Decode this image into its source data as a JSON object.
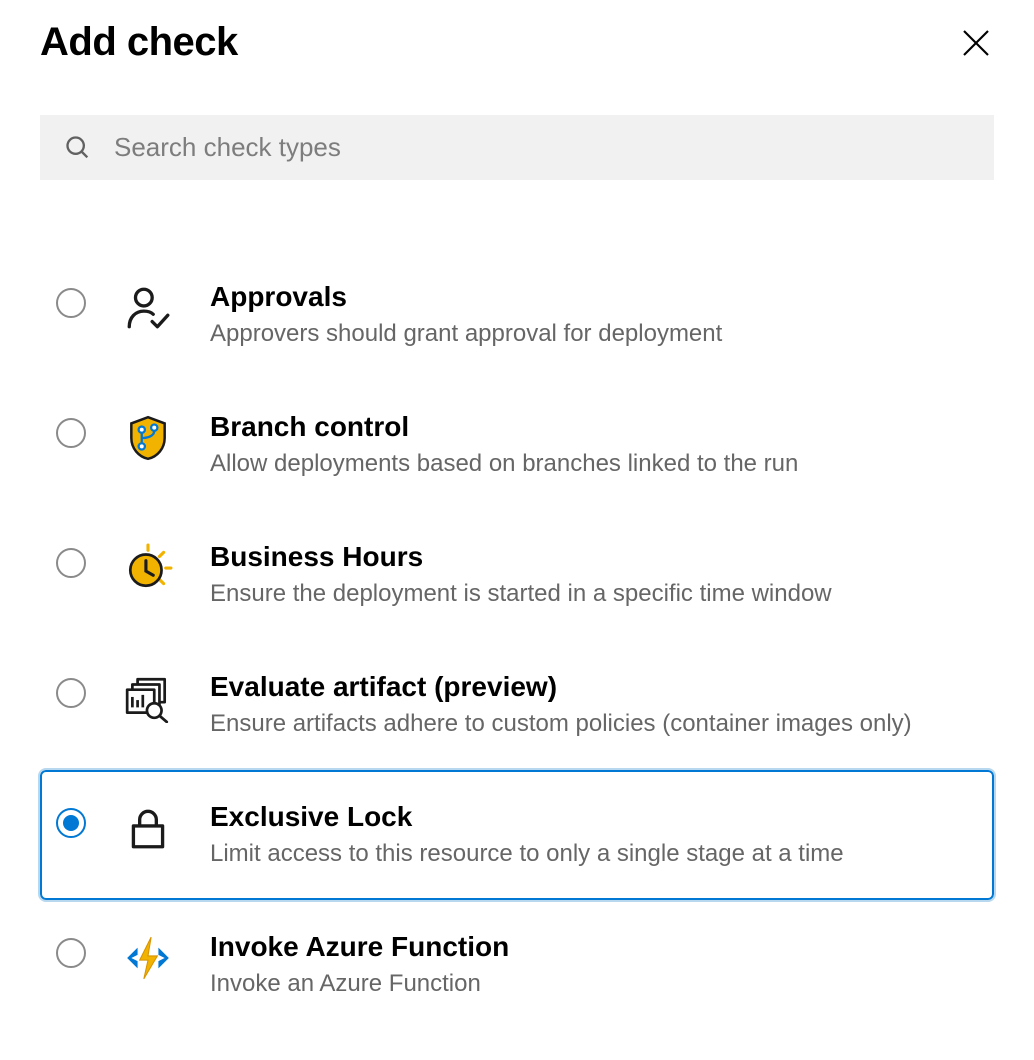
{
  "header": {
    "title": "Add check"
  },
  "search": {
    "placeholder": "Search check types",
    "value": ""
  },
  "checks": [
    {
      "title": "Approvals",
      "desc": "Approvers should grant approval for deployment",
      "selected": false
    },
    {
      "title": "Branch control",
      "desc": "Allow deployments based on branches linked to the run",
      "selected": false
    },
    {
      "title": "Business Hours",
      "desc": "Ensure the deployment is started in a specific time window",
      "selected": false
    },
    {
      "title": "Evaluate artifact (preview)",
      "desc": "Ensure artifacts adhere to custom policies (container images only)",
      "selected": false
    },
    {
      "title": "Exclusive Lock",
      "desc": "Limit access to this resource to only a single stage at a time",
      "selected": true
    },
    {
      "title": "Invoke Azure Function",
      "desc": "Invoke an Azure Function",
      "selected": false
    }
  ]
}
